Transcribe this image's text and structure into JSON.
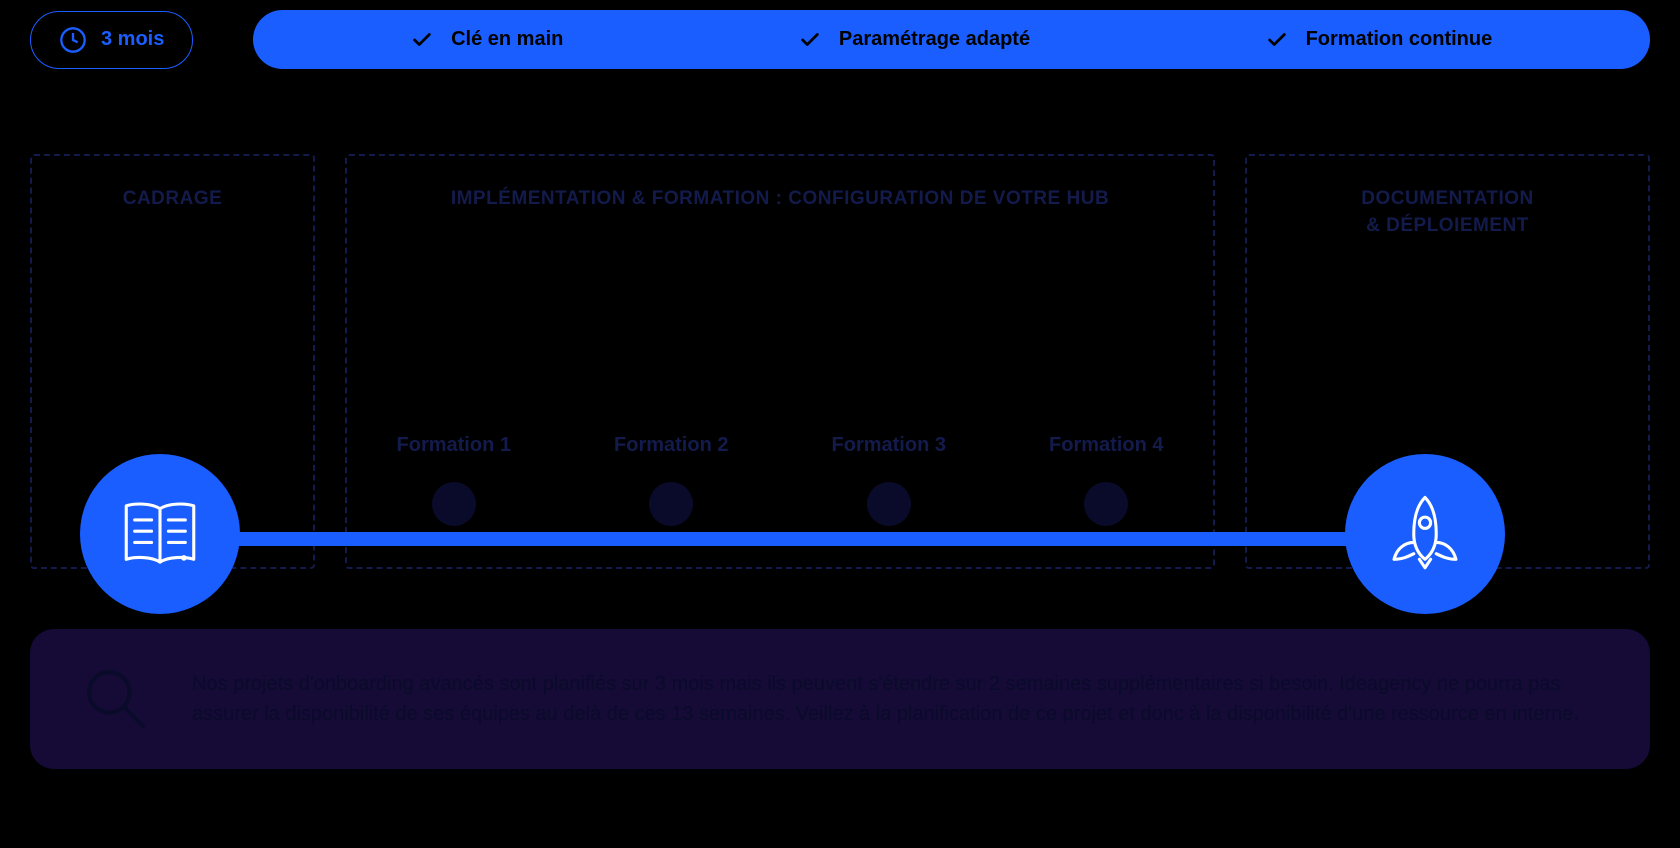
{
  "duration": {
    "label": "3 mois"
  },
  "features": [
    {
      "label": "Clé en main"
    },
    {
      "label": "Paramétrage adapté"
    },
    {
      "label": "Formation continue"
    }
  ],
  "phases": {
    "cadrage": {
      "title": "CADRAGE"
    },
    "impl": {
      "title": "IMPLÉMENTATION & FORMATION : CONFIGURATION DE VOTRE HUB"
    },
    "doc": {
      "title_line1": "DOCUMENTATION",
      "title_line2": "& DÉPLOIEMENT"
    }
  },
  "formations": [
    {
      "label": "Formation 1"
    },
    {
      "label": "Formation 2"
    },
    {
      "label": "Formation 3"
    },
    {
      "label": "Formation 4"
    }
  ],
  "note": {
    "text": "Nos projets d'onboarding avancés sont planifiés sur 3 mois mais ils peuvent s'étendre sur 2 semaines supplémentaires si besoin. Ideagency ne pourra pas assurer la disponibilité de ses équipes au delà de ces 13 semaines. Veillez à la planification de ce projet et donc à la disponibilité d'une ressource en interne."
  }
}
